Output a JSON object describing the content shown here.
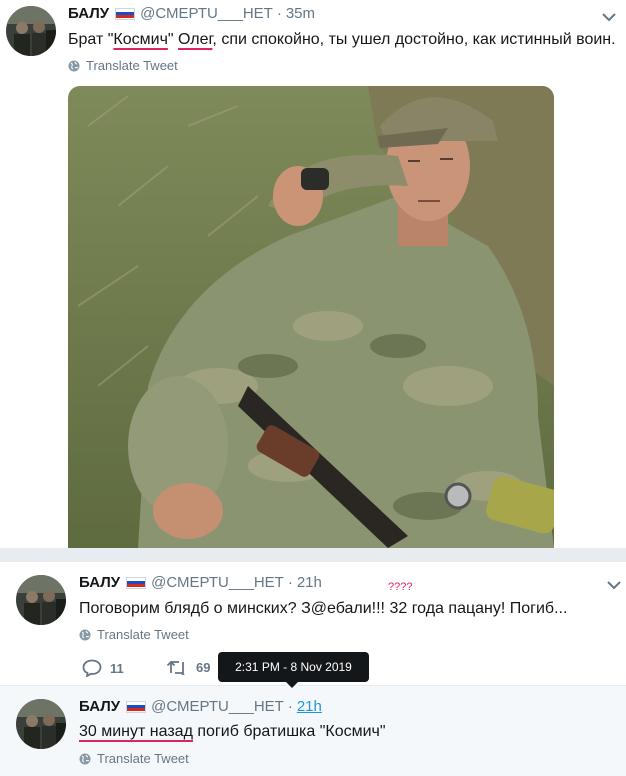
{
  "colors": {
    "text": "#14171a",
    "muted": "#657786",
    "link": "#1b95e0",
    "underline": "#e0245e",
    "background": "#e6ecf0"
  },
  "flag": {
    "colors": [
      "#ffffff",
      "#1c4cc3",
      "#d52b1e"
    ]
  },
  "tweets": [
    {
      "author": "БАЛУ",
      "handle": "@СМЕРТU___НЕТ",
      "separator": "·",
      "time": "35m",
      "text_parts": [
        "Брат \"",
        "Космич",
        "\" ",
        "Олег",
        ", спи спокойно, ты ушел достойно, как истинный  воин."
      ],
      "translate": "Translate Tweet",
      "has_photo": true
    },
    {
      "author": "БАЛУ",
      "handle": "@СМЕРТU___НЕТ",
      "separator": "·",
      "time": "21h",
      "text": "Поговорим блядб о минских? З@ебали!!! 32 года пацану! Погиб...",
      "translate": "Translate Tweet",
      "annotation": "????",
      "replies": "11",
      "retweets": "69"
    },
    {
      "author": "БАЛУ",
      "handle": "@СМЕРТU___НЕТ",
      "separator": "·",
      "time": "21h",
      "text_parts": [
        "30 минут назад",
        " погиб братишка \"Космич\""
      ],
      "translate": "Translate Tweet"
    }
  ],
  "tooltip": {
    "text": "2:31 PM - 8 Nov 2019"
  },
  "icons": [
    "chevron-down-icon",
    "globe-icon",
    "reply-icon",
    "retweet-icon"
  ]
}
